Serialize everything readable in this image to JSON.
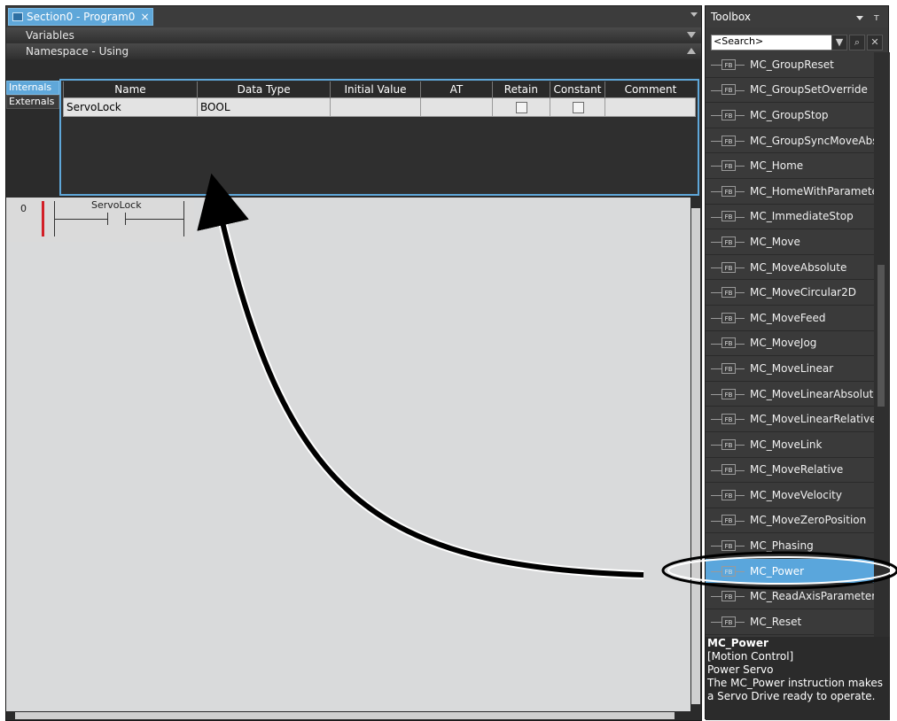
{
  "editor": {
    "tab_label": "Section0 - Program0",
    "close_glyph": "×"
  },
  "panels": {
    "variables": "Variables",
    "namespace": "Namespace - Using"
  },
  "side_tabs": [
    "Internals",
    "Externals"
  ],
  "table": {
    "headers": [
      "Name",
      "Data Type",
      "Initial Value",
      "AT",
      "Retain",
      "Constant",
      "Comment"
    ],
    "rows": [
      {
        "name": "ServoLock",
        "data_type": "BOOL",
        "initial_value": "",
        "at": "",
        "retain": false,
        "constant": false,
        "comment": ""
      }
    ]
  },
  "ladder": {
    "rung_number": "0",
    "contact_label": "ServoLock"
  },
  "toolbox": {
    "title": "Toolbox",
    "search_placeholder": "<Search>",
    "items": [
      "MC_GroupReset",
      "MC_GroupSetOverride",
      "MC_GroupStop",
      "MC_GroupSyncMoveAbs",
      "MC_Home",
      "MC_HomeWithParameter",
      "MC_ImmediateStop",
      "MC_Move",
      "MC_MoveAbsolute",
      "MC_MoveCircular2D",
      "MC_MoveFeed",
      "MC_MoveJog",
      "MC_MoveLinear",
      "MC_MoveLinearAbsolute",
      "MC_MoveLinearRelative",
      "MC_MoveLink",
      "MC_MoveRelative",
      "MC_MoveVelocity",
      "MC_MoveZeroPosition",
      "MC_Phasing",
      "MC_Power",
      "MC_ReadAxisParameter",
      "MC_Reset"
    ],
    "selected_item": "MC_Power",
    "fb_label": "FB",
    "description": {
      "title": "MC_Power",
      "category": "[Motion Control]",
      "summary": "Power Servo",
      "line1": "The MC_Power instruction makes",
      "line2": "a Servo Drive ready to operate."
    }
  },
  "colors": {
    "accent": "#5aa6dc",
    "rung_marker": "#d21f27",
    "editor_bg": "#d9dadb"
  }
}
